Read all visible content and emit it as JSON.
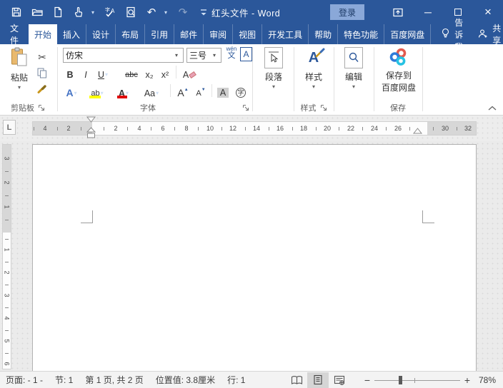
{
  "title_bar": {
    "title": "红头文件 - Word",
    "sign_in_label": "登录",
    "qat_icons": [
      "save",
      "open",
      "new-document",
      "touch-mouse-mode",
      "spelling-grammar",
      "print-preview",
      "undo",
      "redo",
      "customize-quick-access"
    ]
  },
  "tabs": {
    "file": "文件",
    "items": [
      {
        "label": "开始",
        "selected": true
      },
      {
        "label": "插入"
      },
      {
        "label": "设计"
      },
      {
        "label": "布局"
      },
      {
        "label": "引用"
      },
      {
        "label": "邮件"
      },
      {
        "label": "审阅"
      },
      {
        "label": "视图"
      },
      {
        "label": "开发工具"
      },
      {
        "label": "帮助"
      },
      {
        "label": "特色功能"
      },
      {
        "label": "百度网盘"
      }
    ],
    "tell_me": "告诉我",
    "share": "共享"
  },
  "ribbon": {
    "clipboard": {
      "paste_label": "粘贴",
      "group_label": "剪贴板"
    },
    "font": {
      "font_name": "仿宋",
      "font_size": "三号",
      "phonetic_top": "wén",
      "phonetic_bottom": "文",
      "char_border": "A",
      "bold": "B",
      "italic": "I",
      "underline": "U",
      "strikethrough": "abc",
      "subscript": "x₂",
      "superscript": "x²",
      "clear_formatting": "A",
      "text_effects": "A",
      "highlight": "ab",
      "font_color": "A",
      "change_case": "Aa",
      "grow_font": "A",
      "shrink_font": "A",
      "shading": "A",
      "enclose": "字",
      "group_label": "字体"
    },
    "paragraph": {
      "button_label": "段落"
    },
    "styles": {
      "button_label": "样式",
      "group_label": "样式"
    },
    "editing": {
      "button_label": "编辑"
    },
    "save": {
      "button_line1": "保存到",
      "button_line2": "百度网盘",
      "group_label": "保存"
    }
  },
  "ruler": {
    "tab_selector": "L",
    "h_numbers": [
      "4",
      "2",
      "2",
      "4",
      "6",
      "8",
      "10",
      "12",
      "14",
      "16",
      "18",
      "20",
      "22",
      "24",
      "26",
      "30",
      "32"
    ],
    "v_margin_numbers": [
      "3",
      "2",
      "1"
    ],
    "v_numbers": [
      "1",
      "2",
      "3",
      "4",
      "5",
      "6"
    ]
  },
  "status_bar": {
    "page_field": "页面: - 1 -",
    "section": "节: 1",
    "page_count": "第 1 页, 共 2 页",
    "position": "位置值: 3.8厘米",
    "line": "行: 1",
    "view_icons": [
      "read-mode",
      "print-layout",
      "web-layout"
    ],
    "zoom_level": "78%"
  },
  "colors": {
    "titlebar_blue": "#2b579a",
    "active_tab_text": "#2b579a",
    "signin_bg": "#8aa8d8",
    "highlight_yellow": "#ffff00",
    "font_color_red": "#e00000",
    "baidu_red": "#e25a4e",
    "baidu_blue": "#2f7bd9",
    "baidu_cyan": "#27c2e3"
  }
}
